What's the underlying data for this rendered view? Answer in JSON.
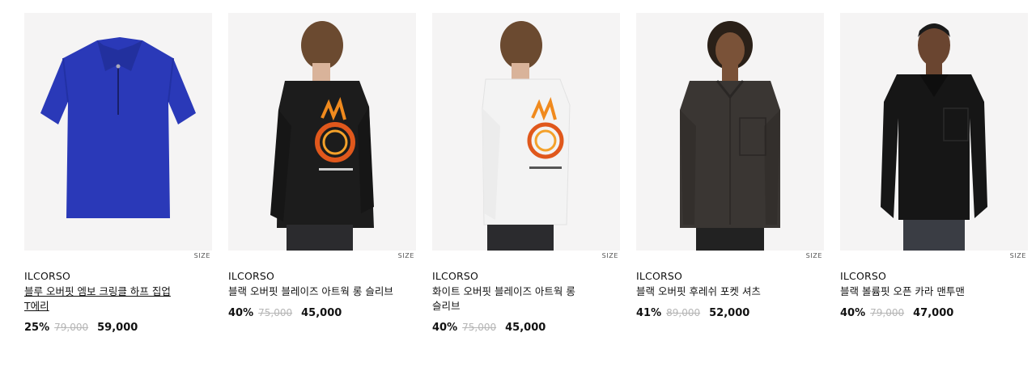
{
  "products": [
    {
      "brand": "ILCORSO",
      "name": "블루 오버핏 엠보 크링클 하프 집업 T에리",
      "discount": "25%",
      "original_price": "79,000",
      "sale_price": "59,000",
      "size_label": "SIZE",
      "image_icon": "blue-half-zip-shirt-icon",
      "color": "#2a39b8"
    },
    {
      "brand": "ILCORSO",
      "name": "블랙 오버핏 블레이즈 아트웍 롱 슬리브",
      "discount": "40%",
      "original_price": "75,000",
      "sale_price": "45,000",
      "size_label": "SIZE",
      "image_icon": "black-long-sleeve-model-back-icon",
      "color": "#1a1a1a"
    },
    {
      "brand": "ILCORSO",
      "name": "화이트 오버핏 블레이즈 아트웍 롱 슬리브",
      "discount": "40%",
      "original_price": "75,000",
      "sale_price": "45,000",
      "size_label": "SIZE",
      "image_icon": "white-long-sleeve-model-back-icon",
      "color": "#f2f2f2"
    },
    {
      "brand": "ILCORSO",
      "name": "블랙 오버핏 후레쉬 포켓 셔츠",
      "discount": "41%",
      "original_price": "89,000",
      "sale_price": "52,000",
      "size_label": "SIZE",
      "image_icon": "black-pocket-shirt-model-icon",
      "color": "#3a3633"
    },
    {
      "brand": "ILCORSO",
      "name": "블랙 볼륨핏 오픈 카라 맨투맨",
      "discount": "40%",
      "original_price": "79,000",
      "sale_price": "47,000",
      "size_label": "SIZE",
      "image_icon": "black-open-collar-sweatshirt-model-icon",
      "color": "#161616"
    }
  ]
}
